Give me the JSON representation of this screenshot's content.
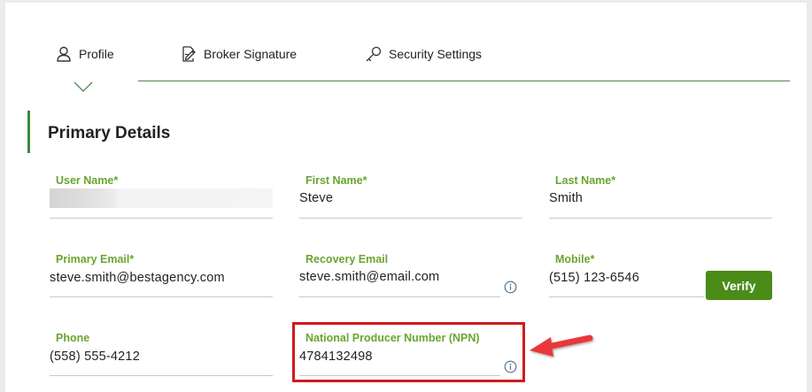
{
  "tabs": [
    {
      "label": "Profile",
      "icon": "user-icon",
      "active": true
    },
    {
      "label": "Broker Signature",
      "icon": "signature-icon",
      "active": false
    },
    {
      "label": "Security Settings",
      "icon": "key-icon",
      "active": false
    }
  ],
  "section": {
    "title": "Primary Details"
  },
  "fields": {
    "user_name": {
      "label": "User Name*",
      "value": ""
    },
    "first_name": {
      "label": "First Name*",
      "value": "Steve"
    },
    "last_name": {
      "label": "Last Name*",
      "value": "Smith"
    },
    "primary_email": {
      "label": "Primary Email*",
      "value": "steve.smith@bestagency.com"
    },
    "recovery_email": {
      "label": "Recovery Email",
      "value": "steve.smith@email.com"
    },
    "mobile": {
      "label": "Mobile*",
      "value": "(515) 123-6546"
    },
    "phone": {
      "label": "Phone",
      "value": "(558) 555-4212"
    },
    "npn": {
      "label": "National Producer Number (NPN)",
      "value": "4784132498"
    }
  },
  "buttons": {
    "verify": "Verify"
  },
  "colors": {
    "accent_green": "#3b8a3e",
    "label_green": "#6aa52f",
    "button_green": "#4b8b17",
    "highlight_red": "#d11a1a"
  }
}
